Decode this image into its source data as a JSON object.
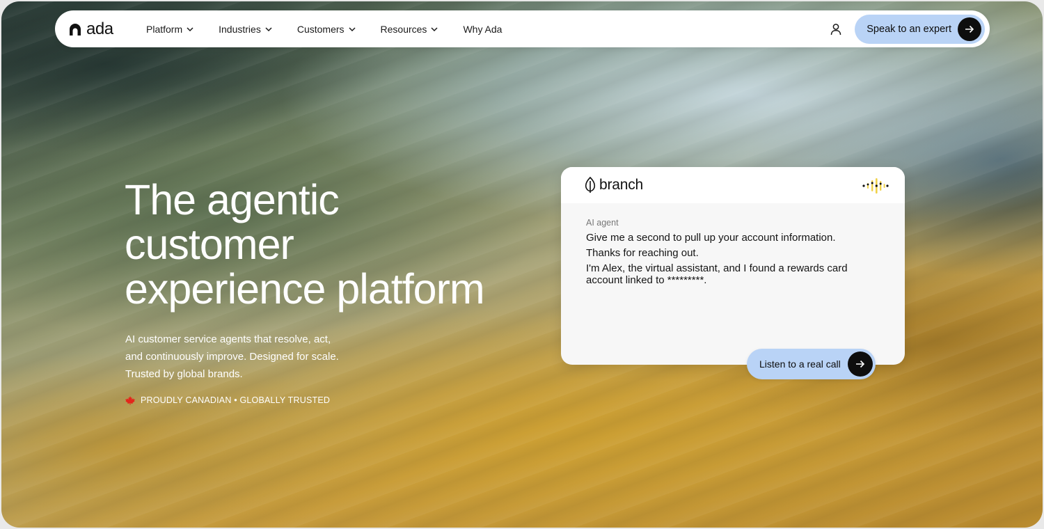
{
  "nav": {
    "logo_text": "ada",
    "items": [
      {
        "label": "Platform",
        "has_dropdown": true
      },
      {
        "label": "Industries",
        "has_dropdown": true
      },
      {
        "label": "Customers",
        "has_dropdown": true
      },
      {
        "label": "Resources",
        "has_dropdown": true
      },
      {
        "label": "Why Ada",
        "has_dropdown": false
      }
    ],
    "user_icon": "user-icon",
    "cta_label": "Speak to an expert",
    "cta_icon": "arrow-right-icon"
  },
  "hero": {
    "title_lines": [
      "The agentic",
      "customer",
      "experience platform"
    ],
    "subtitle": "AI customer service agents that resolve, act, and continuously improve. Designed for scale. Trusted by global brands.",
    "badge": "PROUDLY CANADIAN • GLOBALLY TRUSTED",
    "badge_icon": "maple-leaf-icon"
  },
  "demo_card": {
    "brand_name": "branch",
    "brand_icon": "leaf-icon",
    "wave_icon": "audio-wave-icon",
    "speaker_label": "AI agent",
    "messages": [
      "Give me a second to pull up your account information.",
      "Thanks for reaching out.",
      "I'm Alex, the virtual assistant, and I found a rewards card account linked to *********."
    ],
    "listen_label": "Listen to a real call",
    "listen_icon": "arrow-right-icon"
  },
  "colors": {
    "accent": "#b9d3f6",
    "dark": "#0e0e0e",
    "maple": "#e3261b"
  }
}
